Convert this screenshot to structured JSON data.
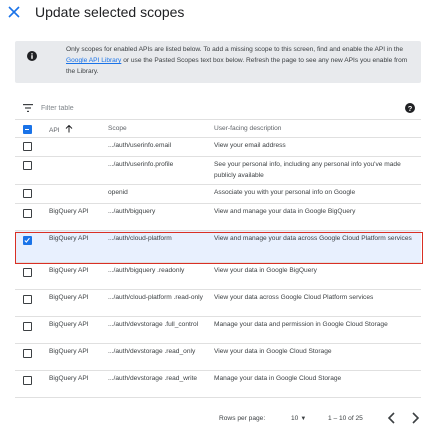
{
  "header": {
    "title": "Update selected scopes"
  },
  "notice": {
    "text_before": "Only scopes for enabled APIs are listed below. To add a missing scope to this screen, find and enable the API in the ",
    "link": "Google API Library",
    "text_after": " or use the Pasted Scopes text box below. Refresh the page to see any new APIs you enable from the Library."
  },
  "filter": {
    "placeholder": "Filter table"
  },
  "table": {
    "headers": {
      "api": "API",
      "scope": "Scope",
      "description": "User-facing description"
    },
    "rows": [
      {
        "api": "",
        "scope": ".../auth/userinfo.email",
        "description": "View your email address",
        "checked": false
      },
      {
        "api": "",
        "scope": ".../auth/userinfo.profile",
        "description": "See your personal info, including any personal info you've made publicly available",
        "checked": false
      },
      {
        "api": "",
        "scope": "openid",
        "description": "Associate you with your personal info on Google",
        "checked": false
      },
      {
        "api": "BigQuery API",
        "scope": ".../auth/bigquery",
        "description": "View and manage your data in Google BigQuery",
        "checked": false
      },
      {
        "api": "BigQuery API",
        "scope": ".../auth/cloud-platform",
        "description": "View and manage your data across Google Cloud Platform services",
        "checked": true
      },
      {
        "api": "BigQuery API",
        "scope": ".../auth/bigquery .readonly",
        "description": "View your data in Google BigQuery",
        "checked": false
      },
      {
        "api": "BigQuery API",
        "scope": ".../auth/cloud-platform .read-only",
        "description": "View your data across Google Cloud Platform services",
        "checked": false
      },
      {
        "api": "BigQuery API",
        "scope": ".../auth/devstorage .full_control",
        "description": "Manage your data and permission in Google Cloud Storage",
        "checked": false
      },
      {
        "api": "BigQuery API",
        "scope": ".../auth/devstorage .read_only",
        "description": "View your data in Google Cloud Storage",
        "checked": false
      },
      {
        "api": "BigQuery API",
        "scope": ".../auth/devstorage .read_write",
        "description": "Manage your data in Google Cloud Storage",
        "checked": false
      }
    ]
  },
  "footer": {
    "rows_per_page_label": "Rows per page:",
    "rows_per_page_value": "10",
    "range": "1 – 10 of 25"
  },
  "colors": {
    "accent": "#1a73e8",
    "highlight": "#d93025",
    "notice_bg": "#e8eaed"
  }
}
